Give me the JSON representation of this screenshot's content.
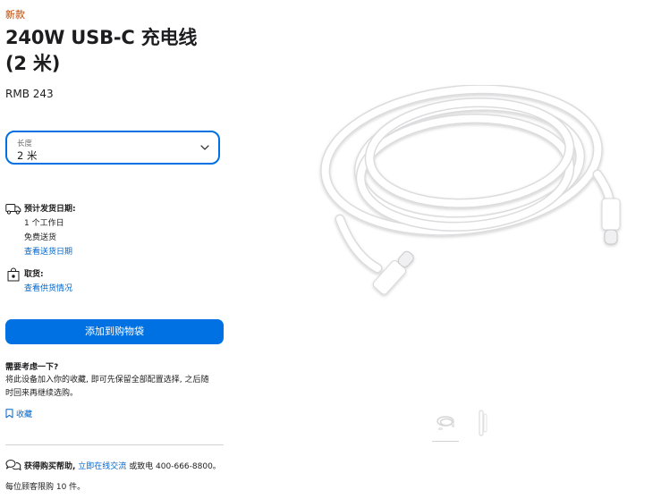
{
  "product": {
    "badge": "新款",
    "title_line1": "240W USB-C 充电线",
    "title_line2": "(2 米)",
    "price": "RMB 243"
  },
  "length_select": {
    "label": "长度",
    "value": "2 米"
  },
  "delivery": {
    "title": "预计发货日期:",
    "line1": "1 个工作日",
    "line2": "免费送货",
    "link": "查看送货日期"
  },
  "pickup": {
    "title": "取货:",
    "link": "查看供货情况"
  },
  "add_to_bag_label": "添加到购物袋",
  "consider": {
    "title": "需要考虑一下?",
    "text": "将此设备加入你的收藏, 即可先保留全部配置选择, 之后随时回来再继续选购。",
    "save_label": "收藏"
  },
  "help": {
    "bold": "获得购买帮助,",
    "link": "立即在线交流",
    "rest": "或致电 400-666-8800。"
  },
  "limit_text": "每位顾客限购 10 件。",
  "colors": {
    "accent": "#0071e3",
    "link": "#0066cc",
    "new_badge": "#b64400"
  },
  "icons": [
    "chevron-down-icon",
    "delivery-truck-icon",
    "store-bag-icon",
    "bookmark-icon",
    "chat-bubbles-icon"
  ]
}
